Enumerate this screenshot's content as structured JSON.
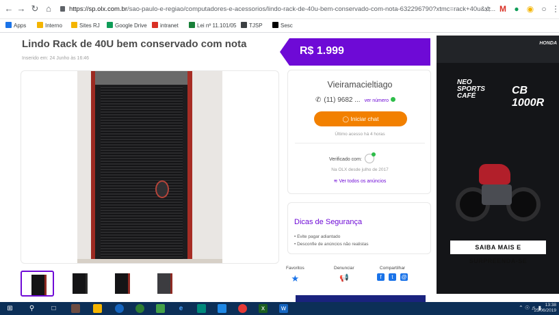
{
  "browser": {
    "url_host": "https://sp.olx.com.br",
    "url_path": "/sao-paulo-e-regiao/computadores-e-acessorios/lindo-rack-de-40u-bem-conservado-com-nota-632296790?xtmc=rack+40u&xt...",
    "bookmarks": [
      {
        "label": "Apps",
        "color": "#1a73e8"
      },
      {
        "label": "Interno",
        "color": "#f4b400"
      },
      {
        "label": "Sites RJ",
        "color": "#f4b400"
      },
      {
        "label": "Google Drive",
        "color": "#0f9d58"
      },
      {
        "label": "intranet",
        "color": "#d93025"
      },
      {
        "label": "Lei nº 11.101/05",
        "color": "#188038"
      },
      {
        "label": "TJSP",
        "color": "#3c4043"
      },
      {
        "label": "Sesc",
        "color": "#000000"
      }
    ]
  },
  "listing": {
    "title": "Lindo Rack de 40U bem conservado com nota",
    "inserted": "Inserido em: 24 Junho às 16:46",
    "price": "R$ 1.999"
  },
  "seller": {
    "name": "Vieiramacieltiago",
    "phone": "(11) 9682 ...",
    "reveal_phone": "ver número",
    "chat_button": "Iniciar chat",
    "last_access": "Último acesso há 4 horas",
    "verified_label": "Verificado com:",
    "since": "Na OLX desde julho de 2017",
    "all_ads": "Ver todos os anúncios"
  },
  "safety": {
    "title": "Dicas de Segurança",
    "items": [
      "Evite pagar adiantado",
      "Desconfie de anúncios não realistas"
    ]
  },
  "actions": {
    "favorites": "Favoritos",
    "report": "Denunciar",
    "share": "Compartilhar"
  },
  "ad": {
    "brand": "HONDA",
    "line1": "NEO",
    "line2": "SPORTS",
    "line3": "CAFÉ",
    "model": "CB 1000R",
    "cta": "SAIBA MAIS E SURPREENDA-SE"
  },
  "taskbar": {
    "time": "13:38",
    "date": "25/06/2019"
  },
  "colors": {
    "olx_purple": "#6e0ad6",
    "olx_orange": "#f28000",
    "taskbar": "#0c2f57"
  }
}
